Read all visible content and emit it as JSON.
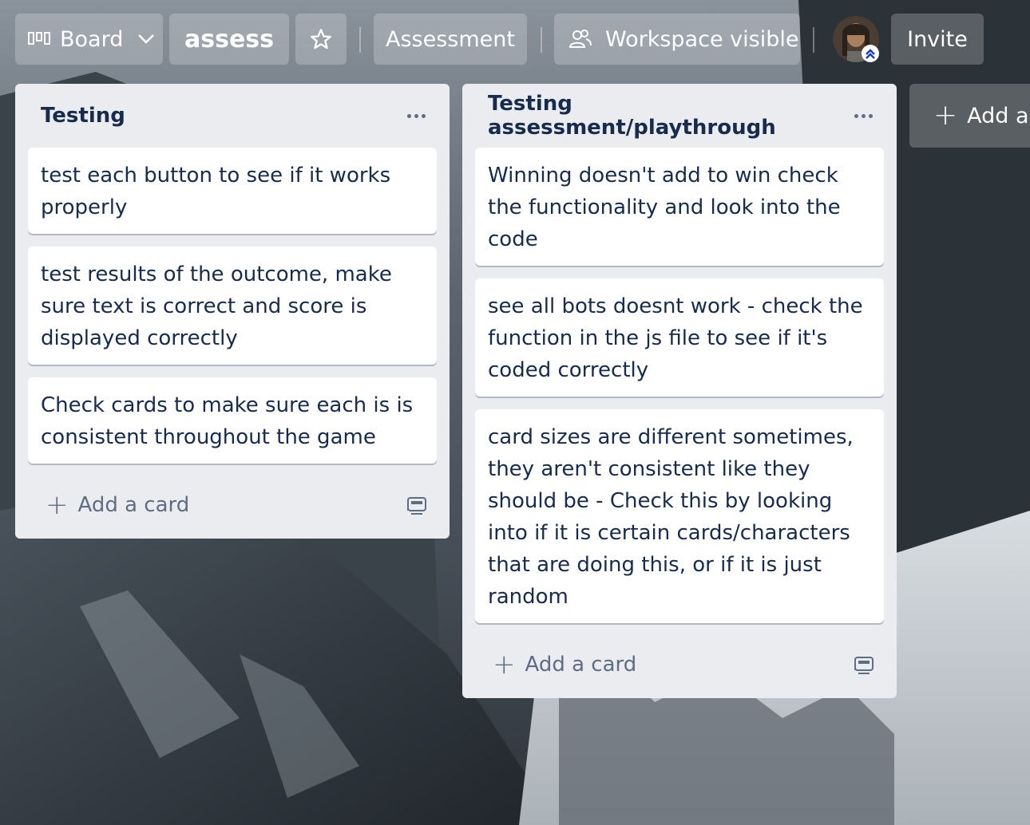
{
  "header": {
    "view_label": "Board",
    "board_name": "assess",
    "workspace_label": "Assessment",
    "visibility_label": "Workspace visible",
    "invite_label": "Invite"
  },
  "lists": [
    {
      "title": "Testing",
      "cards": [
        "test each button to see if it works properly",
        "test results of the outcome, make sure text is correct and score is displayed correctly",
        "Check cards to make sure each is is consistent throughout the game"
      ],
      "add_card_label": "Add a card"
    },
    {
      "title": "Testing assessment/playthrough",
      "cards": [
        "Winning doesn't add to win check the functionality and look into the code",
        "see all bots doesnt work - check the function in the js file to see if it's coded correctly",
        "card sizes are different sometimes, they aren't consistent like they should be - Check this by looking into if it is certain cards/characters that are doing this, or if it is just random"
      ],
      "add_card_label": "Add a card"
    }
  ],
  "add_list_label": "Add another list",
  "colors": {
    "list_bg": "#ebecf0",
    "card_bg": "#ffffff",
    "text": "#172b4d",
    "muted": "#5e6c84"
  }
}
